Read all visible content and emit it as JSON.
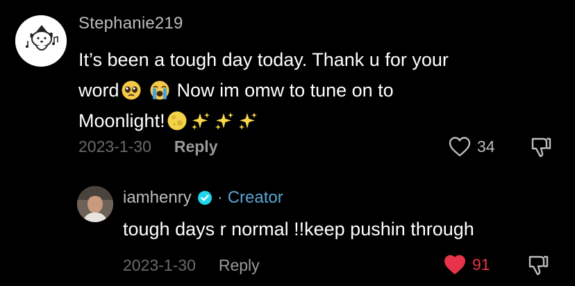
{
  "comment": {
    "username": "Stephanie219",
    "text_line1": "It’s been a tough day today. Thank u for your",
    "text_line2_a": "word",
    "text_line2_b": "Now im omw to tune on to",
    "text_line3": "Moonlight!",
    "date": "2023-1-30",
    "reply_label": "Reply",
    "likes": "34",
    "liked": false,
    "avatar_icon": "dog-cartoon-avatar",
    "emojis": [
      "pleading-face-icon",
      "loudly-crying-face-icon",
      "full-moon-icon",
      "sparkles-icon",
      "sparkles-icon",
      "sparkles-icon"
    ]
  },
  "reply": {
    "username": "iamhenry",
    "separator": "·",
    "badge": "Creator",
    "text": "tough days r normal !!keep pushin through",
    "date": "2023-1-30",
    "reply_label": "Reply",
    "likes": "91",
    "liked": true,
    "avatar_icon": "user-photo-avatar"
  },
  "colors": {
    "background": "#000000",
    "username": "#bdbdbd",
    "meta": "#6b6b6b",
    "creator": "#5aa6d6",
    "liked": "#e8344a",
    "verified": "#20d5ec"
  }
}
